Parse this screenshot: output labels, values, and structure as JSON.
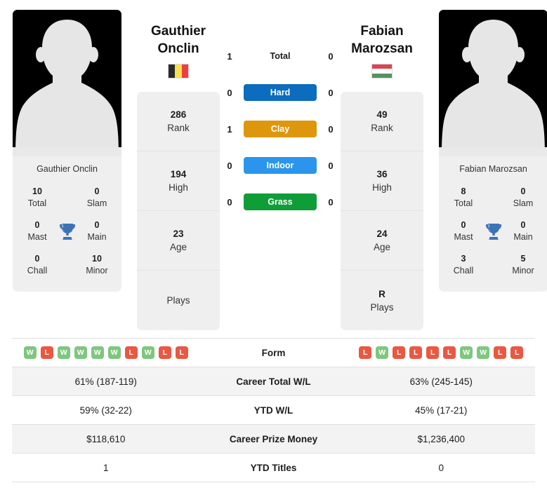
{
  "colors": {
    "win": "#7ec77e",
    "loss": "#ea5842",
    "hard": "#0c6cbd",
    "clay": "#de960c",
    "indoor": "#2b95ed",
    "grass": "#0f9d38",
    "trophy": "#3d73b5",
    "row_alt": "#f3f3f3",
    "card_bg": "#efefef"
  },
  "left_player": {
    "name_line1": "Gauthier",
    "name_line2": "Onclin",
    "card_name": "Gauthier Onclin",
    "flag": "belgium-flag",
    "flag_colors": [
      "#2b2b2b",
      "#fadf50",
      "#ef3e42"
    ],
    "titles": [
      {
        "value": "10",
        "label": "Total"
      },
      {
        "value": "0",
        "label": "Slam"
      },
      {
        "value": "0",
        "label": "Mast"
      },
      {
        "value": "0",
        "label": "Main"
      },
      {
        "value": "0",
        "label": "Chall"
      },
      {
        "value": "10",
        "label": "Minor"
      }
    ],
    "ranking": [
      {
        "value": "286",
        "label": "Rank"
      },
      {
        "value": "194",
        "label": "High"
      },
      {
        "value": "23",
        "label": "Age"
      },
      {
        "value": "",
        "label": "Plays"
      }
    ],
    "form": [
      "W",
      "L",
      "W",
      "W",
      "W",
      "W",
      "L",
      "W",
      "L",
      "L"
    ],
    "career_total_wl": "61% (187-119)",
    "ytd_wl": "59% (32-22)",
    "career_prize_money": "$118,610",
    "ytd_titles": "1"
  },
  "right_player": {
    "name_line1": "Fabian",
    "name_line2": "Marozsan",
    "card_name": "Fabian Marozsan",
    "flag": "hungary-flag",
    "flag_colors": [
      "#da4453",
      "#ffffff",
      "#56925e"
    ],
    "titles": [
      {
        "value": "8",
        "label": "Total"
      },
      {
        "value": "0",
        "label": "Slam"
      },
      {
        "value": "0",
        "label": "Mast"
      },
      {
        "value": "0",
        "label": "Main"
      },
      {
        "value": "3",
        "label": "Chall"
      },
      {
        "value": "5",
        "label": "Minor"
      }
    ],
    "ranking": [
      {
        "value": "49",
        "label": "Rank"
      },
      {
        "value": "36",
        "label": "High"
      },
      {
        "value": "24",
        "label": "Age"
      },
      {
        "value": "R",
        "label": "Plays"
      }
    ],
    "form": [
      "L",
      "W",
      "L",
      "L",
      "L",
      "L",
      "W",
      "W",
      "L",
      "L"
    ],
    "career_total_wl": "63% (245-145)",
    "ytd_wl": "45% (17-21)",
    "career_prize_money": "$1,236,400",
    "ytd_titles": "0"
  },
  "head_to_head": [
    {
      "label": "Total",
      "left": "1",
      "right": "0",
      "surface": false,
      "color": ""
    },
    {
      "label": "Hard",
      "left": "0",
      "right": "0",
      "surface": true,
      "color": "#0c6cbd"
    },
    {
      "label": "Clay",
      "left": "1",
      "right": "0",
      "surface": true,
      "color": "#de960c"
    },
    {
      "label": "Indoor",
      "left": "0",
      "right": "0",
      "surface": true,
      "color": "#2b95ed"
    },
    {
      "label": "Grass",
      "left": "0",
      "right": "0",
      "surface": true,
      "color": "#0f9d38"
    }
  ],
  "table_rows": [
    {
      "label": "Form",
      "key": "form",
      "type": "form"
    },
    {
      "label": "Career Total W/L",
      "key": "career_total_wl",
      "type": "text"
    },
    {
      "label": "YTD W/L",
      "key": "ytd_wl",
      "type": "text"
    },
    {
      "label": "Career Prize Money",
      "key": "career_prize_money",
      "type": "text"
    },
    {
      "label": "YTD Titles",
      "key": "ytd_titles",
      "type": "text"
    }
  ]
}
